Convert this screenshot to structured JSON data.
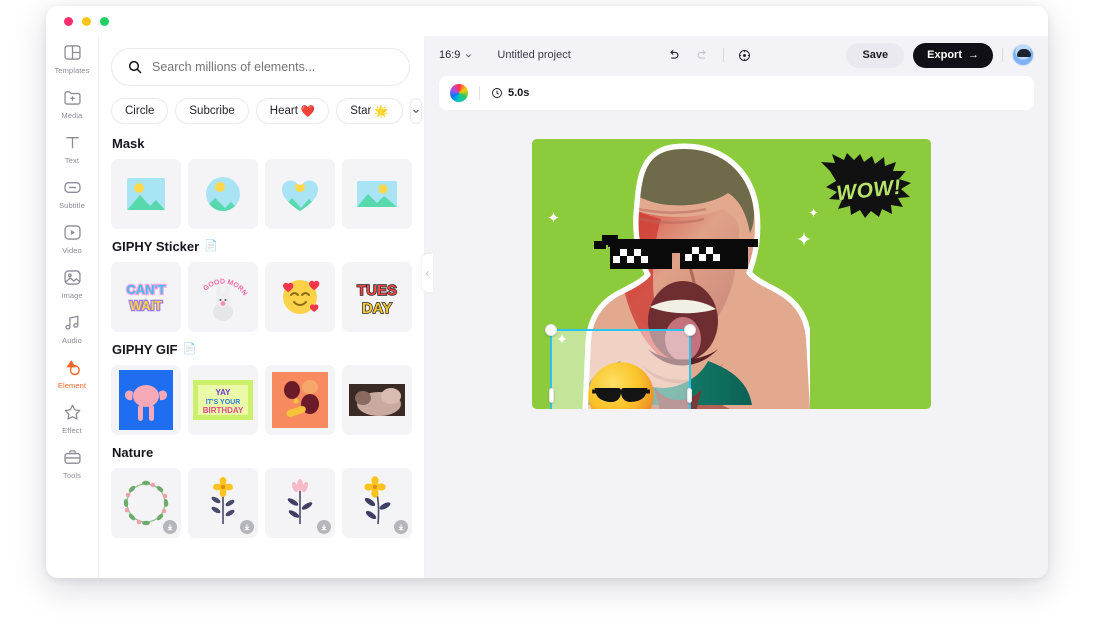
{
  "window": {
    "dots": [
      "close",
      "minimize",
      "maximize"
    ]
  },
  "sidebar": {
    "items": [
      {
        "label": "Templates",
        "icon": "templates-icon",
        "active": false
      },
      {
        "label": "Media",
        "icon": "media-folder-plus-icon",
        "active": false
      },
      {
        "label": "Text",
        "icon": "text-t-icon",
        "active": false
      },
      {
        "label": "Subtitle",
        "icon": "subtitle-icon",
        "active": false
      },
      {
        "label": "Video",
        "icon": "video-play-icon",
        "active": false
      },
      {
        "label": "Image",
        "icon": "image-icon",
        "active": false
      },
      {
        "label": "Audio",
        "icon": "audio-note-icon",
        "active": false
      },
      {
        "label": "Element",
        "icon": "element-shapes-icon",
        "active": true
      },
      {
        "label": "Effect",
        "icon": "effect-sparkle-icon",
        "active": false
      },
      {
        "label": "Tools",
        "icon": "tools-briefcase-icon",
        "active": false
      }
    ]
  },
  "panel": {
    "search": {
      "placeholder": "Search millions of elements...",
      "value": "",
      "icon": "search-icon"
    },
    "chips": [
      {
        "label": "Circle",
        "emoji": ""
      },
      {
        "label": "Subcribe",
        "emoji": ""
      },
      {
        "label": "Heart",
        "emoji": "❤️"
      },
      {
        "label": "Star",
        "emoji": "🌟"
      }
    ],
    "chip_more_icon": "chevron-down-icon",
    "sections": [
      {
        "title": "Mask",
        "badge": "",
        "items": [
          {
            "name": "mask-rectangle"
          },
          {
            "name": "mask-circle"
          },
          {
            "name": "mask-heart"
          },
          {
            "name": "mask-rectangle-wide"
          }
        ]
      },
      {
        "title": "GIPHY Sticker",
        "badge": "📄",
        "items": [
          {
            "name": "sticker-cant-wait",
            "text": "CAN'T WAIT"
          },
          {
            "name": "sticker-good-morning",
            "text": "GOOD MORNING"
          },
          {
            "name": "sticker-smiling-hearts",
            "text": "🥰"
          },
          {
            "name": "sticker-tuesday",
            "text": "TUES DAY"
          }
        ]
      },
      {
        "title": "GIPHY GIF",
        "badge": "📄",
        "items": [
          {
            "name": "gif-strong-brain"
          },
          {
            "name": "gif-yay-its-your-birthday",
            "text": "YAY IT'S YOUR BIRTHDAY"
          },
          {
            "name": "gif-orange-abstract"
          },
          {
            "name": "gif-cat-photo"
          }
        ]
      },
      {
        "title": "Nature",
        "badge": "",
        "items": [
          {
            "name": "nature-floral-wreath",
            "downloadable": true
          },
          {
            "name": "nature-yellow-flower",
            "downloadable": true
          },
          {
            "name": "nature-pink-tulip",
            "downloadable": true
          },
          {
            "name": "nature-yellow-daisy",
            "downloadable": true
          }
        ]
      }
    ],
    "collapse_icon": "chevron-left-icon"
  },
  "editor": {
    "ratio": {
      "value": "16:9",
      "icon": "chevron-down-icon"
    },
    "project_name": "Untitled project",
    "tools": [
      {
        "name": "undo-icon",
        "enabled": true
      },
      {
        "name": "redo-icon",
        "enabled": false
      },
      {
        "name": "fit-to-screen-icon",
        "enabled": true
      }
    ],
    "save_label": "Save",
    "export_label": "Export",
    "export_arrow": "→",
    "avatar": "user-avatar",
    "subbar": {
      "color_icon": "color-wheel-icon",
      "duration_icon": "clock-icon",
      "duration": "5.0s"
    },
    "canvas": {
      "background_color": "#8ccc3c",
      "wow_text": "WOW!",
      "wow_text_color": "#b7e36a",
      "wow_shape": "starburst-black",
      "subject": "man-shouting-with-pixel-sunglasses",
      "selection": {
        "color": "#2bc4ef",
        "element": "cool-sunglasses-emoji"
      },
      "cursor": "mouse-pointer"
    }
  }
}
